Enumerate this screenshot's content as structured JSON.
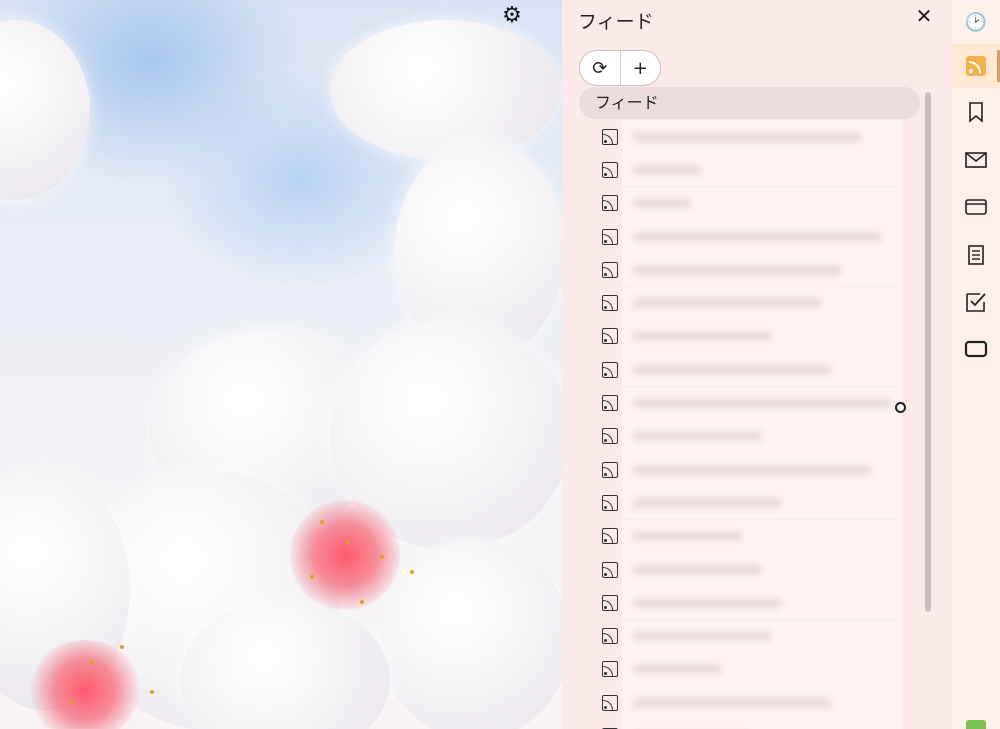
{
  "wallpaper": {
    "accent": "#ff5a6e"
  },
  "toolbar": {
    "settings_icon": "gear-icon"
  },
  "panel": {
    "title": "フィード",
    "close_icon": "close-icon",
    "refresh_icon": "refresh-icon",
    "add_icon": "plus-icon",
    "feed_header": "フィード",
    "feed_count": 19
  },
  "sidebar": {
    "items": [
      {
        "name": "history",
        "icon": "clock-icon",
        "glyph": "🕑"
      },
      {
        "name": "feeds",
        "icon": "rss-icon",
        "active": true
      },
      {
        "name": "bookmarks",
        "icon": "bookmark-icon",
        "glyph": "🔖"
      },
      {
        "name": "mail",
        "icon": "mail-icon",
        "glyph": "✉"
      },
      {
        "name": "wallet",
        "icon": "card-icon",
        "glyph": "▭"
      },
      {
        "name": "notes",
        "icon": "notes-icon",
        "glyph": "≣"
      },
      {
        "name": "tasks",
        "icon": "checkbox-icon",
        "glyph": "☑"
      },
      {
        "name": "window",
        "icon": "window-icon",
        "glyph": "▢"
      }
    ]
  },
  "colors": {
    "panel_bg": "#fceae9",
    "active_accent": "#f3b24a",
    "status_green": "#7bc04f"
  }
}
